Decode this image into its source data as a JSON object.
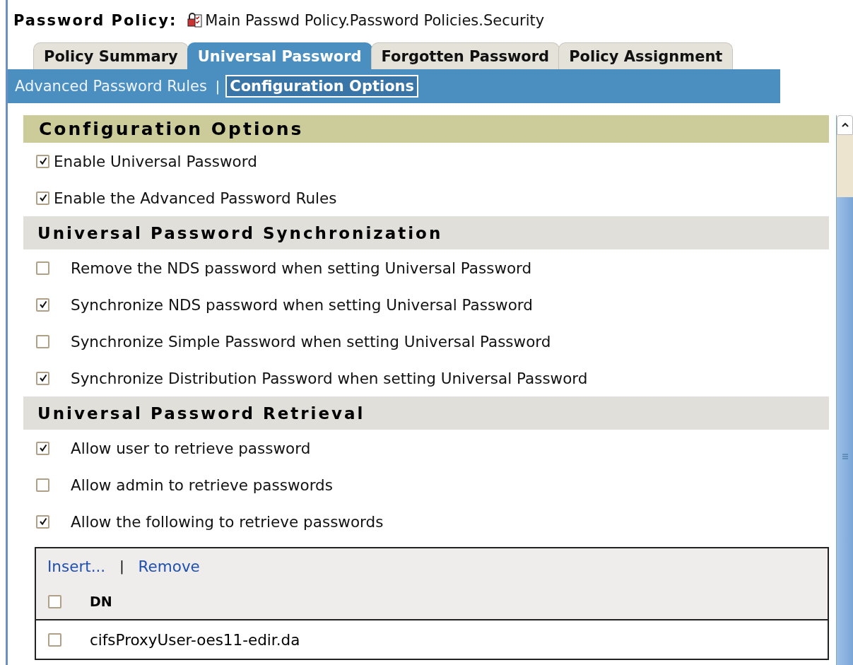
{
  "header": {
    "label": "Password Policy:",
    "object": "Main Passwd Policy.Password Policies.Security"
  },
  "tabs": [
    {
      "label": "Policy Summary",
      "selected": false
    },
    {
      "label": "Universal Password",
      "selected": true
    },
    {
      "label": "Forgotten Password",
      "selected": false
    },
    {
      "label": "Policy Assignment",
      "selected": false
    }
  ],
  "subtab_separator": "|",
  "subtabs": [
    {
      "label": "Advanced Password Rules",
      "selected": false
    },
    {
      "label": "Configuration Options",
      "selected": true
    }
  ],
  "sections": [
    {
      "kind": "primary",
      "title": "Configuration Options",
      "options": [
        {
          "label": "Enable Universal Password",
          "checked": true
        },
        {
          "label": "Enable the Advanced Password Rules",
          "checked": true
        }
      ]
    },
    {
      "kind": "secondary",
      "title": "Universal Password Synchronization",
      "options": [
        {
          "label": "Remove the NDS password when setting Universal Password",
          "checked": false
        },
        {
          "label": "Synchronize NDS password when setting Universal Password",
          "checked": true
        },
        {
          "label": "Synchronize Simple Password when setting Universal Password",
          "checked": false
        },
        {
          "label": "Synchronize Distribution Password when setting Universal Password",
          "checked": true
        }
      ]
    },
    {
      "kind": "secondary",
      "title": "Universal Password Retrieval",
      "options": [
        {
          "label": "Allow user to retrieve password",
          "checked": true
        },
        {
          "label": "Allow admin to retrieve passwords",
          "checked": false
        },
        {
          "label": "Allow the following to retrieve passwords",
          "checked": true
        }
      ]
    }
  ],
  "retrievers": {
    "actions": [
      "Insert...",
      "Remove"
    ],
    "action_separator": "|",
    "column": "DN",
    "header_checked": false,
    "rows": [
      {
        "dn": "cifsProxyUser-oes11-edir.da",
        "checked": false
      }
    ]
  }
}
